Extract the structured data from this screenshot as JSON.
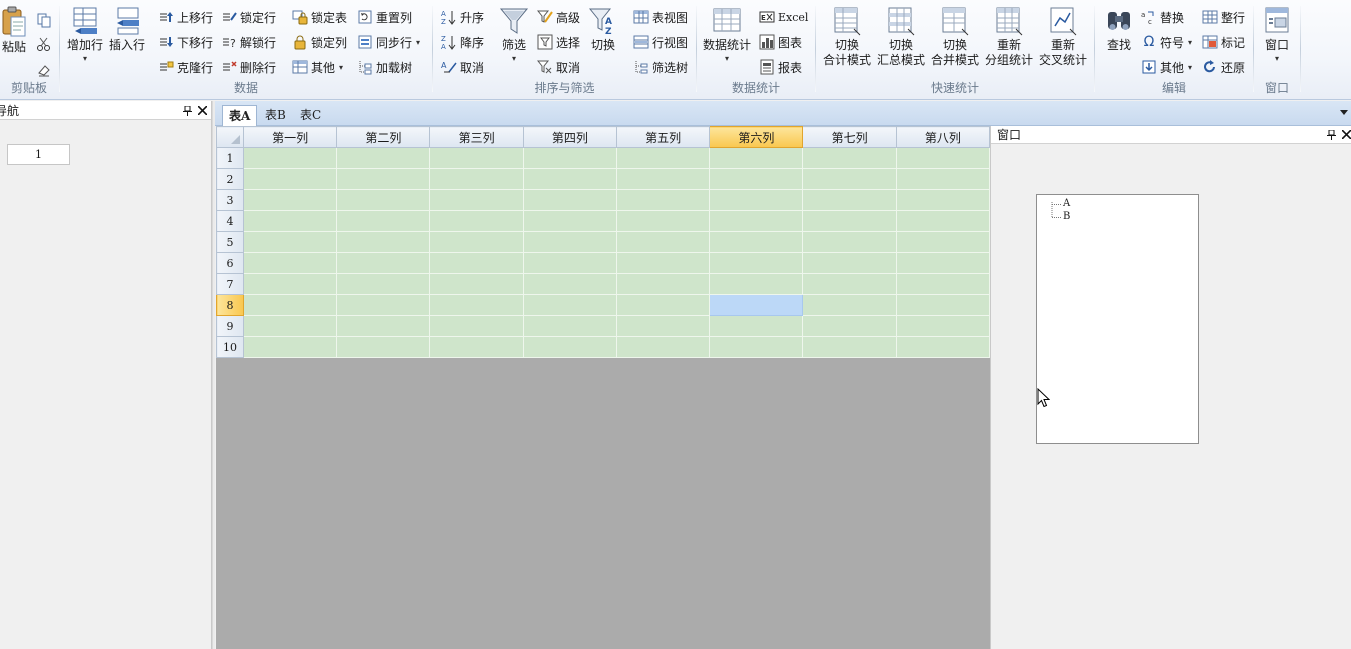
{
  "ribbon": {
    "clipboard": {
      "group_label": "剪贴板",
      "paste": "粘贴"
    },
    "data": {
      "group_label": "数据",
      "add_row": "增加行",
      "insert_row": "插入行",
      "move_up": "上移行",
      "move_down": "下移行",
      "clone_row": "克隆行",
      "lock_row": "锁定行",
      "unlock_row": "解锁行",
      "delete_row": "删除行",
      "lock_table": "锁定表",
      "lock_col": "锁定列",
      "other": "其他",
      "reset_col": "重置列",
      "sync_row": "同步行",
      "load_tree": "加载树"
    },
    "sort_filter": {
      "group_label": "排序与筛选",
      "asc": "升序",
      "desc": "降序",
      "cancel_sort": "取消",
      "filter": "筛选",
      "advanced": "高级",
      "select": "选择",
      "cancel_filter": "取消",
      "toggle": "切换",
      "table_view": "表视图",
      "row_view": "行视图",
      "filter_tree": "筛选树"
    },
    "stats": {
      "group_label": "数据统计",
      "data_stats": "数据统计",
      "excel": "Excel",
      "chart": "图表",
      "report": "报表"
    },
    "quick_stats": {
      "group_label": "快速统计",
      "buttons": [
        {
          "line1": "切换",
          "line2": "合计模式"
        },
        {
          "line1": "切换",
          "line2": "汇总模式"
        },
        {
          "line1": "切换",
          "line2": "合并模式"
        },
        {
          "line1": "重新",
          "line2": "分组统计"
        },
        {
          "line1": "重新",
          "line2": "交叉统计"
        }
      ]
    },
    "edit": {
      "group_label": "编辑",
      "find": "查找",
      "replace": "替换",
      "symbol": "符号",
      "other": "其他",
      "whole_row": "整行",
      "mark": "标记",
      "restore": "还原"
    },
    "window": {
      "group_label": "窗口",
      "window": "窗口"
    }
  },
  "nav_panel": {
    "title": "导航",
    "page_value": "1"
  },
  "tabs": [
    "表A",
    "表B",
    "表C"
  ],
  "grid": {
    "columns": [
      "第一列",
      "第二列",
      "第三列",
      "第四列",
      "第五列",
      "第六列",
      "第七列",
      "第八列"
    ],
    "rows": [
      "1",
      "2",
      "3",
      "4",
      "5",
      "6",
      "7",
      "8",
      "9",
      "10"
    ],
    "selected_column": "第六列",
    "selected_row": "8"
  },
  "window_panel": {
    "title": "窗口",
    "tree_items": [
      "A",
      "B"
    ]
  },
  "colors": {
    "grid_cell": "#cfe5cb",
    "selection": "#bcd8f7",
    "header_selected": "#f9c74f",
    "empty_area": "#ababab"
  }
}
